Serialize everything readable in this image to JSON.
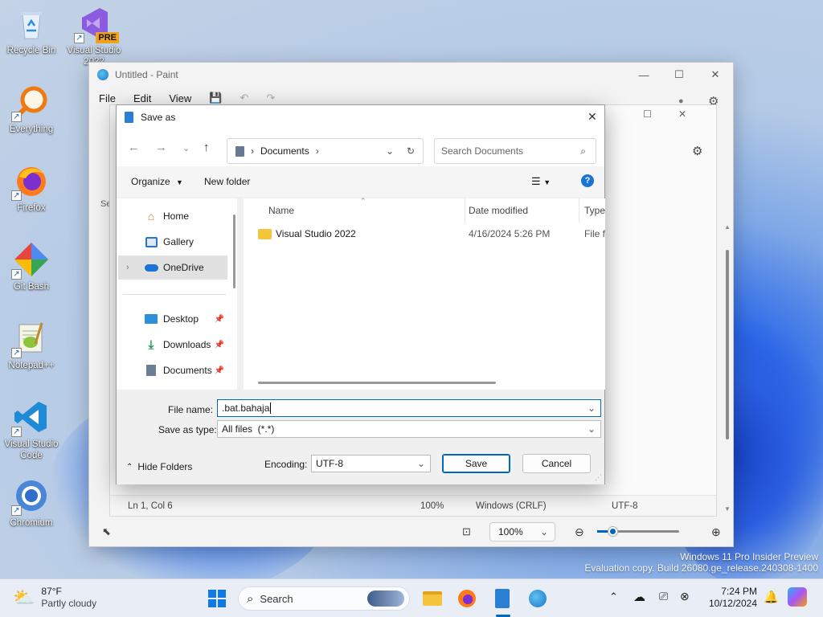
{
  "desktop": {
    "icons": [
      {
        "label": "Recycle Bin",
        "icon": "recycle-bin-icon"
      },
      {
        "label": "Visual Studio 2022",
        "badge": "PRE",
        "icon": "visual-studio-icon"
      },
      {
        "label": "Everything",
        "icon": "everything-search-icon"
      },
      {
        "label": "Firefox",
        "icon": "firefox-icon"
      },
      {
        "label": "Git Bash",
        "icon": "git-bash-icon"
      },
      {
        "label": "Notepad++",
        "icon": "notepad-plus-plus-icon"
      },
      {
        "label": "Visual Studio Code",
        "icon": "vscode-icon"
      },
      {
        "label": "Chromium",
        "icon": "chromium-icon"
      }
    ],
    "watermark": {
      "line1": "Windows 11 Pro Insider Preview",
      "line2": "Evaluation copy. Build 26080.ge_release.240308-1400"
    }
  },
  "paint": {
    "title": "Untitled - Paint",
    "menu": [
      "File",
      "Edit",
      "View"
    ],
    "side_label": "Se",
    "zoom": "100%"
  },
  "notepad": {
    "status": {
      "position": "Ln 1, Col 6",
      "zoom": "100%",
      "line_ending": "Windows (CRLF)",
      "encoding": "UTF-8"
    }
  },
  "dialog": {
    "title": "Save as",
    "breadcrumb": "Documents",
    "search_placeholder": "Search Documents",
    "organize_label": "Organize",
    "new_folder_label": "New folder",
    "nav_items": [
      {
        "label": "Home",
        "icon": "home-icon"
      },
      {
        "label": "Gallery",
        "icon": "gallery-icon"
      },
      {
        "label": "OneDrive",
        "icon": "onedrive-icon"
      },
      {
        "label": "Desktop",
        "icon": "desktop-folder-icon"
      },
      {
        "label": "Downloads",
        "icon": "downloads-icon"
      },
      {
        "label": "Documents",
        "icon": "documents-icon"
      }
    ],
    "columns": [
      "Name",
      "Date modified",
      "Type"
    ],
    "files": [
      {
        "name": "Visual Studio 2022",
        "date": "4/16/2024 5:26 PM",
        "type": "File fo"
      }
    ],
    "file_name_label": "File name:",
    "file_name_value": ".bat.bahaja",
    "save_type_label": "Save as type:",
    "save_type_value": "All files  (*.*)",
    "hide_folders_label": "Hide Folders",
    "encoding_label": "Encoding:",
    "encoding_value": "UTF-8",
    "save_label": "Save",
    "cancel_label": "Cancel"
  },
  "taskbar": {
    "weather_temp": "87°F",
    "weather_desc": "Partly cloudy",
    "search_label": "Search",
    "time": "7:24 PM",
    "date": "10/12/2024",
    "accent": "#0067c0"
  }
}
